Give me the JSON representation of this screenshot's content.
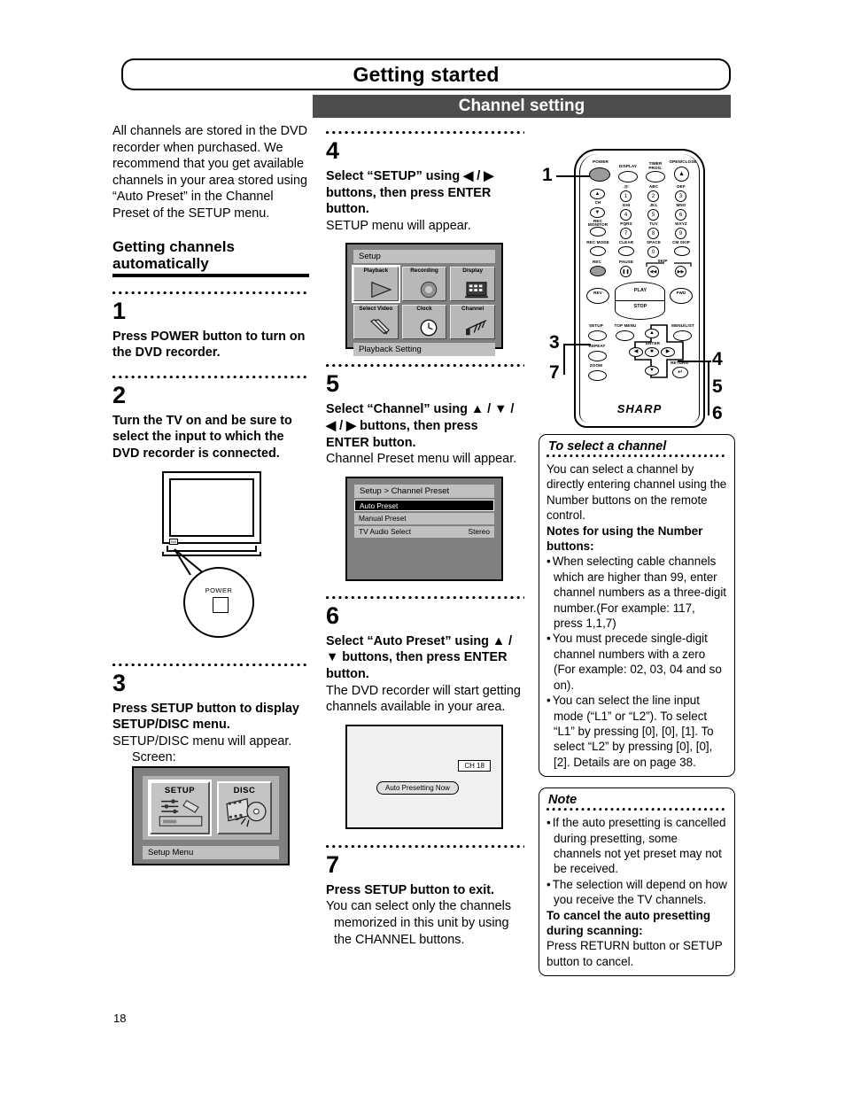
{
  "header": {
    "title": "Getting started",
    "section": "Channel setting"
  },
  "page_number": "18",
  "intro": {
    "paragraph": "All channels are stored in the DVD recorder when purchased. We recommend that you get available channels in your area stored using “Auto Preset” in the Channel Preset of the SETUP menu.",
    "heading": "Getting channels automatically"
  },
  "steps": [
    {
      "num": "1",
      "bold": "Press POWER button to turn on the DVD recorder.",
      "plain": ""
    },
    {
      "num": "2",
      "bold": "Turn the TV on and be sure to select the input to which the DVD recorder is connected.",
      "plain": ""
    },
    {
      "num": "3",
      "bold": "Press SETUP button to display SETUP/DISC menu.",
      "plain": "SETUP/DISC menu will appear.",
      "screen_label": "Screen:"
    },
    {
      "num": "4",
      "bold": "Select “SETUP” using ◀ / ▶ buttons, then press ENTER button.",
      "plain": "SETUP menu will appear."
    },
    {
      "num": "5",
      "bold": "Select “Channel” using ▲ / ▼ / ◀ / ▶ buttons, then press ENTER button.",
      "plain": "Channel Preset menu will appear."
    },
    {
      "num": "6",
      "bold": "Select “Auto Preset” using ▲ / ▼ buttons, then press ENTER button.",
      "plain": "The DVD recorder will start getting channels available in your area."
    },
    {
      "num": "7",
      "bold": "Press SETUP button to exit.",
      "bullet": "You can select only the channels memorized in this unit by using the CHANNEL buttons."
    }
  ],
  "tv_illustration": {
    "power_label": "POWER",
    "led_label": "SW"
  },
  "osd_setup_disc": {
    "tile_setup": "SETUP",
    "tile_disc": "DISC",
    "status_bar": "Setup Menu"
  },
  "osd_setup_menu": {
    "title_bar": "Setup",
    "tiles": [
      {
        "label": "Playback",
        "icon": "play-triangle-icon",
        "selected": true
      },
      {
        "label": "Recording",
        "icon": "record-circle-icon",
        "selected": false
      },
      {
        "label": "Display",
        "icon": "display-monitor-icon",
        "selected": false
      },
      {
        "label": "Select Video",
        "icon": "pencils-icon",
        "selected": false
      },
      {
        "label": "Clock",
        "icon": "clock-icon",
        "selected": false
      },
      {
        "label": "Channel",
        "icon": "antenna-icon",
        "selected": false
      }
    ],
    "status_bar": "Playback Setting"
  },
  "osd_channel_preset": {
    "title_bar": "Setup > Channel Preset",
    "rows": [
      {
        "label": "Auto Preset",
        "value": "",
        "selected": true
      },
      {
        "label": "Manual Preset",
        "value": "",
        "selected": false
      },
      {
        "label": "TV Audio Select",
        "value": "Stereo",
        "selected": false
      }
    ]
  },
  "osd_auto_presetting": {
    "channel_badge": "CH 18",
    "status_pill": "Auto Presetting Now"
  },
  "remote": {
    "brand": "SHARP",
    "callouts": [
      "1",
      "3",
      "7",
      "4",
      "5",
      "6"
    ],
    "keys": {
      "power": "POWER",
      "display": "DISPLAY",
      "timer_prog": "TIMER PROG.",
      "open_close": "OPEN/CLOSE",
      "ch_up": "▲",
      "ch": "CH",
      "ch_down": "▼",
      "rec_monitor": "REC MONITOR",
      "rec_mode": "REC MODE",
      "clear": "CLEAR",
      "space": "SPACE",
      "cm_skip": "CM SKIP",
      "rec": "REC",
      "pause": "PAUSE",
      "skip": "SKIP",
      "rev": "REV",
      "play": "PLAY",
      "fwd": "FWD",
      "stop": "STOP",
      "setup": "SETUP",
      "top_menu": "TOP MENU",
      "menu_list": "MENU/LIST",
      "repeat": "REPEAT",
      "enter": "ENTER",
      "zoom": "ZOOM",
      "return": "RETURN"
    },
    "number_pad": [
      {
        "letters": ".@:",
        "digit": "1"
      },
      {
        "letters": "ABC",
        "digit": "2"
      },
      {
        "letters": "DEF",
        "digit": "3"
      },
      {
        "letters": "GHI",
        "digit": "4"
      },
      {
        "letters": "JKL",
        "digit": "5"
      },
      {
        "letters": "MNO",
        "digit": "6"
      },
      {
        "letters": "PQRS",
        "digit": "7"
      },
      {
        "letters": "TUV",
        "digit": "8"
      },
      {
        "letters": "WXYZ",
        "digit": "9"
      },
      {
        "letters": "",
        "digit": "0"
      }
    ]
  },
  "select_channel_box": {
    "title": "To select a channel",
    "intro": "You can select a channel by directly entering channel using the Number buttons on the remote control.",
    "notes_heading": "Notes for using the Number buttons:",
    "bullets": [
      "When selecting cable channels which are higher than 99, enter channel numbers as a three-digit number.(For example: 117, press 1,1,7)",
      "You must precede single-digit channel numbers with a zero (For example: 02, 03, 04 and so on).",
      "You can select the line input mode (“L1” or “L2”).  To select “L1” by pressing [0], [0], [1]. To select “L2” by pressing [0], [0], [2]. Details are on page 38."
    ]
  },
  "note_box": {
    "title": "Note",
    "bullets": [
      "If the auto presetting is cancelled during presetting, some channels not yet preset may not be received.",
      "The selection will depend on how you receive the TV channels."
    ],
    "cancel_heading": "To cancel the auto presetting during scanning:",
    "cancel_text": "Press RETURN button or SETUP button to cancel."
  }
}
